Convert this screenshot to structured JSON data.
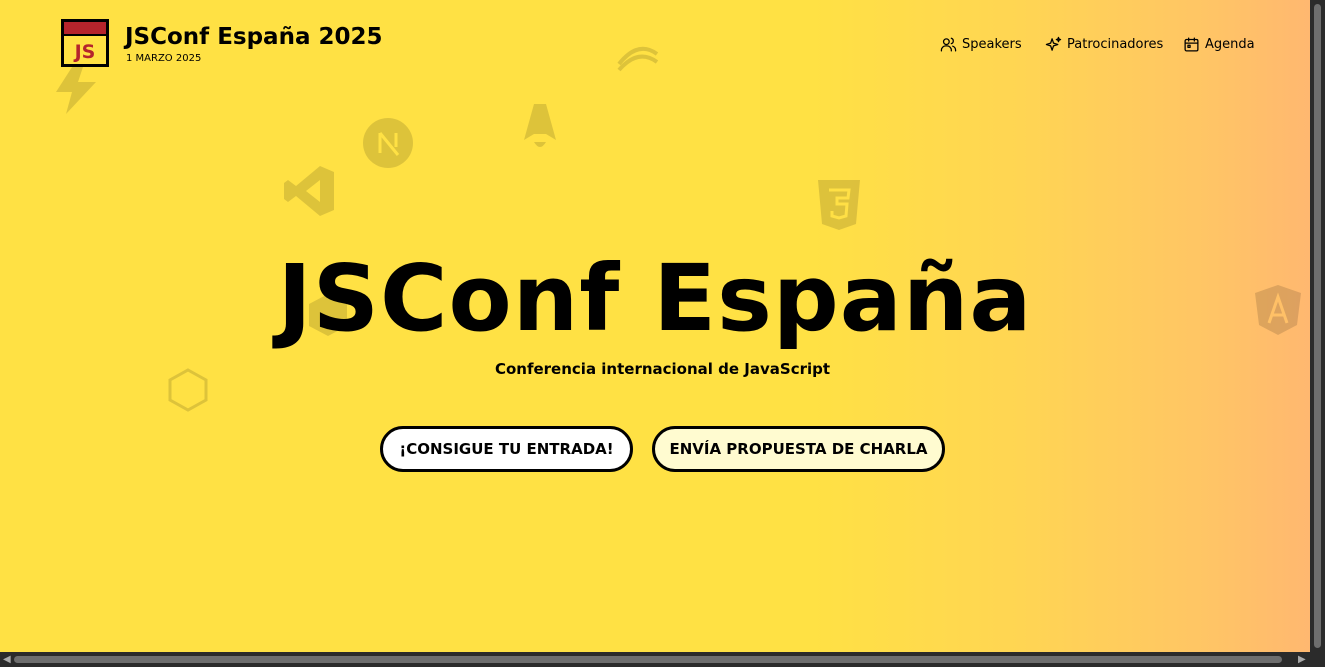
{
  "header": {
    "logo_text": "JS",
    "title": "JSConf España 2025",
    "date": "1 MARZO 2025"
  },
  "nav": {
    "items": [
      {
        "label": "Speakers",
        "icon": "users-icon"
      },
      {
        "label": "Patrocinadores",
        "icon": "sparkles-icon"
      },
      {
        "label": "Agenda",
        "icon": "calendar-icon"
      }
    ]
  },
  "hero": {
    "title": "JSConf España",
    "subtitle": "Conferencia internacional de JavaScript",
    "cta_ticket": "¡CONSIGUE TU ENTRADA!",
    "cta_talk": "ENVÍA PROPUESTA DE CHARLA"
  },
  "background_icons": [
    "lightning-icon",
    "nextjs-icon",
    "astro-icon",
    "vscode-icon",
    "html5-icon",
    "angular-icon",
    "react-icon",
    "generic-icon"
  ],
  "colors": {
    "background_start": "#ffe144",
    "background_end": "#ffb870",
    "logo_red": "#b5242c",
    "text": "#000000"
  }
}
